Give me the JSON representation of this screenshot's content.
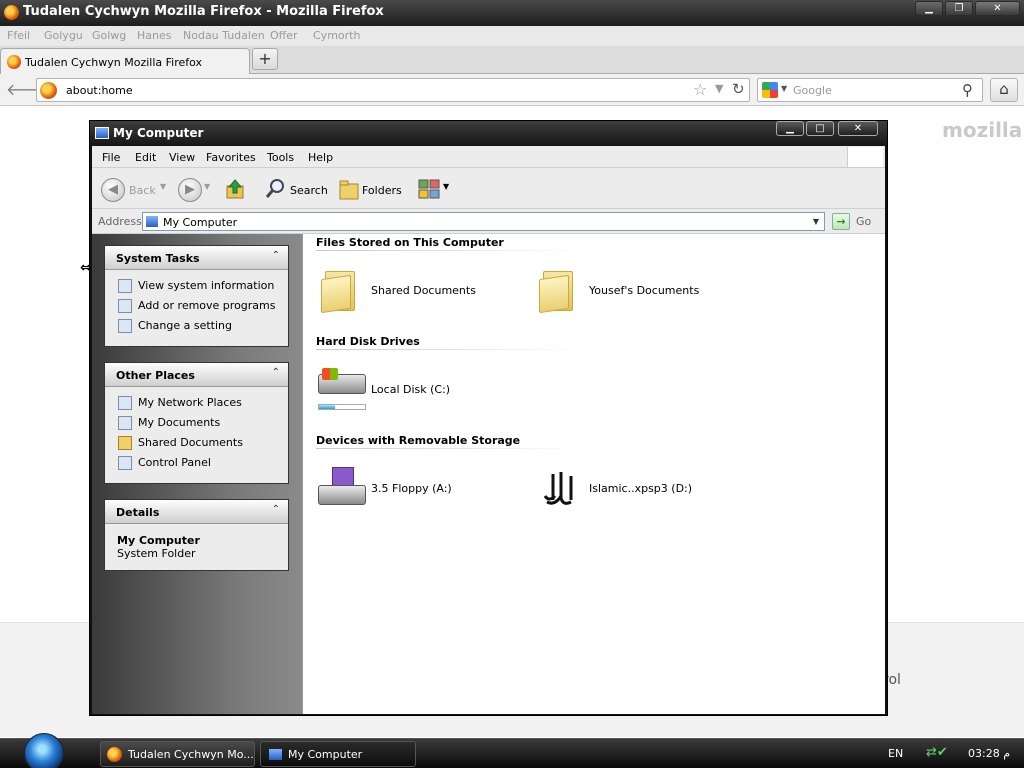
{
  "firefox": {
    "window_title": "Tudalen Cychwyn Mozilla Firefox - Mozilla Firefox",
    "menu": [
      "Ffeil",
      "Golygu",
      "Golwg",
      "Hanes",
      "Nodau Tudalen",
      "Offer",
      "Cymorth"
    ],
    "tab_label": "Tudalen Cychwyn Mozilla Firefox",
    "url": "about:home",
    "search_placeholder": "Google",
    "brand": "mozilla",
    "partial_text": "rol"
  },
  "explorer": {
    "title": "My Computer",
    "menu": [
      "File",
      "Edit",
      "View",
      "Favorites",
      "Tools",
      "Help"
    ],
    "toolbar": {
      "back": "Back",
      "search": "Search",
      "folders": "Folders"
    },
    "address_label": "Address",
    "address_value": "My Computer",
    "go_label": "Go",
    "system_tasks": {
      "title": "System Tasks",
      "items": [
        "View system information",
        "Add or remove programs",
        "Change a setting"
      ]
    },
    "other_places": {
      "title": "Other Places",
      "items": [
        "My Network Places",
        "My Documents",
        "Shared Documents",
        "Control Panel"
      ]
    },
    "details": {
      "title": "Details",
      "name": "My Computer",
      "type": "System Folder"
    },
    "sections": {
      "files": {
        "heading": "Files Stored on This Computer",
        "items": [
          "Shared Documents",
          "Yousef's Documents"
        ]
      },
      "hdd": {
        "heading": "Hard Disk Drives",
        "items": [
          {
            "label": "Local Disk (C:)",
            "usage": 0.35
          }
        ]
      },
      "removable": {
        "heading": "Devices with Removable Storage",
        "items": [
          "3.5 Floppy (A:)",
          "Islamic..xpsp3 (D:)"
        ]
      }
    }
  },
  "taskbar": {
    "tasks": [
      "Tudalen Cychwyn Mo...",
      "My Computer"
    ],
    "language": "EN",
    "clock": "03:28 م"
  }
}
